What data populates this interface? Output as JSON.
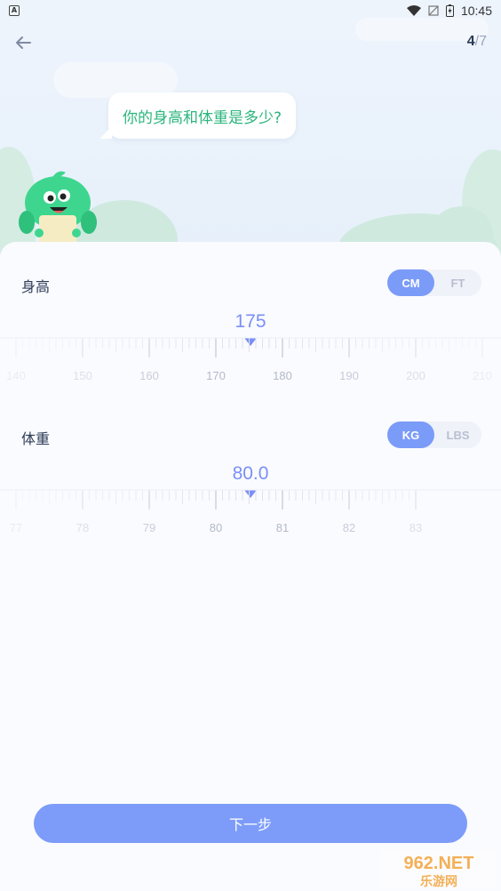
{
  "status_bar": {
    "notification_badge": "A",
    "time": "10:45",
    "icons": [
      "wifi-icon",
      "signal-off-icon",
      "battery-charging-icon"
    ]
  },
  "header": {
    "back_icon": "arrow-left-icon",
    "step_current": "4",
    "step_separator": "/",
    "step_total": "7"
  },
  "question": "你的身高和体重是多少?",
  "height": {
    "label": "身高",
    "unit_options": [
      "CM",
      "FT"
    ],
    "selected_unit": "CM",
    "value": "175",
    "scale_labels": [
      "140",
      "150",
      "160",
      "170",
      "180",
      "190",
      "200",
      "210"
    ]
  },
  "weight": {
    "label": "体重",
    "unit_options": [
      "KG",
      "LBS"
    ],
    "selected_unit": "KG",
    "value": "80.0",
    "scale_labels": [
      "77",
      "78",
      "79",
      "80",
      "81",
      "82",
      "83"
    ]
  },
  "next_button": "下一步",
  "watermark": {
    "line1": "962.NET",
    "line2": "乐游网"
  },
  "colors": {
    "accent": "#7b9bf8",
    "mascot_green": "#3ed68f",
    "question_text": "#2bb57c"
  }
}
